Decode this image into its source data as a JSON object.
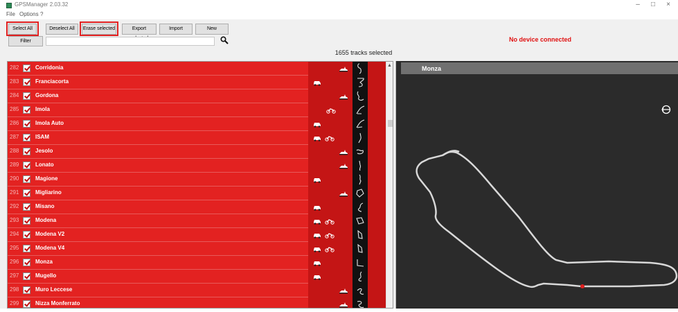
{
  "window": {
    "title": "GPSManager 2.03.32",
    "minimize": "–",
    "maximize": "□",
    "close": "×"
  },
  "menu": {
    "file": "File",
    "options": "Options",
    "help": "?"
  },
  "toolbar": {
    "select_all": "Select All",
    "deselect_all": "Deselect All",
    "erase_selected": "Erase selected",
    "export_selected": "Export selected",
    "import": "Import",
    "new": "New",
    "filter": "Filter"
  },
  "filter": {
    "value": ""
  },
  "status": {
    "device": "No device connected",
    "tracks_selected": "1655 tracks selected"
  },
  "colors": {
    "row_red": "#e32221",
    "dark_red": "#c41515",
    "device_status": "#e01010",
    "map_bg": "#2b2b2b",
    "track_line": "#d8d8d8",
    "marker": "#e02020"
  },
  "tracks": [
    {
      "num": "282",
      "name": "Corridonia",
      "vehicles": [
        "kart"
      ]
    },
    {
      "num": "283",
      "name": "Franciacorta",
      "vehicles": [
        "car"
      ]
    },
    {
      "num": "284",
      "name": "Gordona",
      "vehicles": [
        "kart"
      ]
    },
    {
      "num": "285",
      "name": "Imola",
      "vehicles": [
        "bike"
      ]
    },
    {
      "num": "286",
      "name": "Imola Auto",
      "vehicles": [
        "car"
      ]
    },
    {
      "num": "287",
      "name": "ISAM",
      "vehicles": [
        "car",
        "bike"
      ]
    },
    {
      "num": "288",
      "name": "Jesolo",
      "vehicles": [
        "kart"
      ]
    },
    {
      "num": "289",
      "name": "Lonato",
      "vehicles": [
        "kart"
      ]
    },
    {
      "num": "290",
      "name": "Magione",
      "vehicles": [
        "car"
      ]
    },
    {
      "num": "291",
      "name": "Migliarino",
      "vehicles": [
        "kart"
      ]
    },
    {
      "num": "292",
      "name": "Misano",
      "vehicles": [
        "car"
      ]
    },
    {
      "num": "293",
      "name": "Modena",
      "vehicles": [
        "car",
        "bike"
      ]
    },
    {
      "num": "294",
      "name": "Modena V2",
      "vehicles": [
        "car",
        "bike"
      ]
    },
    {
      "num": "295",
      "name": "Modena V4",
      "vehicles": [
        "car",
        "bike"
      ]
    },
    {
      "num": "296",
      "name": "Monza",
      "vehicles": [
        "car"
      ]
    },
    {
      "num": "297",
      "name": "Mugello",
      "vehicles": [
        "car"
      ]
    },
    {
      "num": "298",
      "name": "Muro Leccese",
      "vehicles": [
        "kart"
      ]
    },
    {
      "num": "299",
      "name": "Nizza Monferrato",
      "vehicles": [
        "kart"
      ]
    }
  ],
  "map": {
    "title": "Monza",
    "compass_icon": "rotate-icon"
  }
}
